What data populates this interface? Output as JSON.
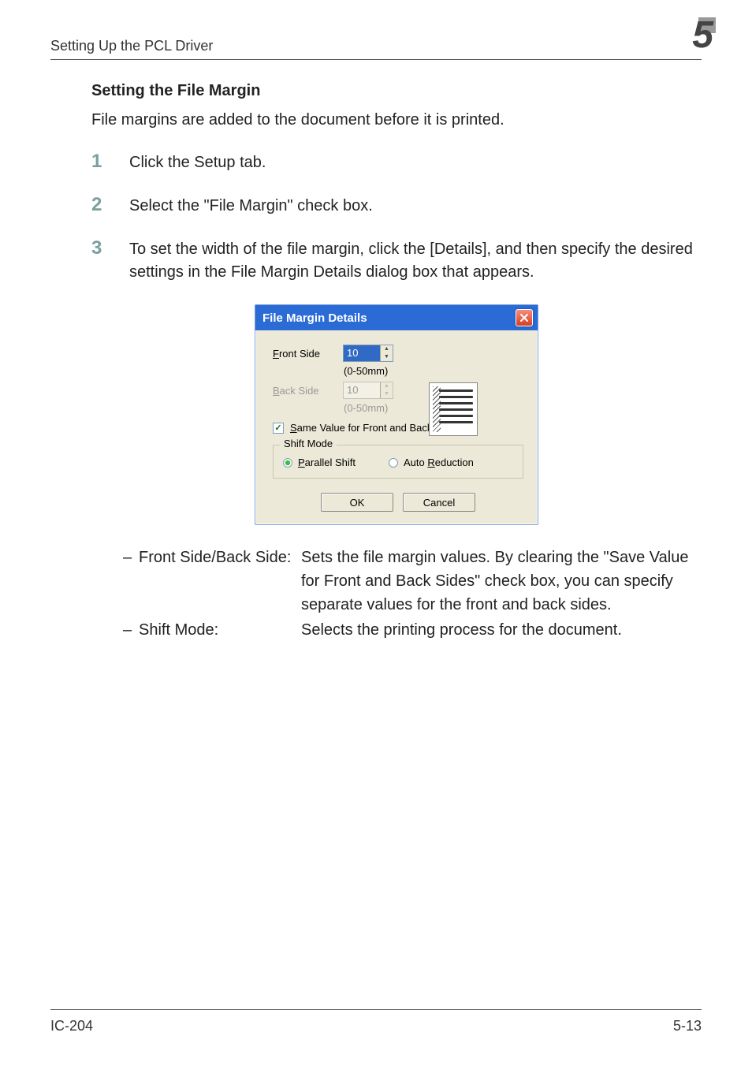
{
  "header": {
    "section_title": "Setting Up the PCL Driver",
    "chapter_number": "5"
  },
  "section": {
    "heading": "Setting the File Margin",
    "intro": "File margins are added to the document before it is printed."
  },
  "steps": {
    "s1_num": "1",
    "s1_text": "Click the Setup tab.",
    "s2_num": "2",
    "s2_text": "Select the \"File Margin\" check box.",
    "s3_num": "3",
    "s3_text": "To set the width of the file margin, click the [Details], and then specify the desired settings in the File Margin Details dialog box that appears."
  },
  "dialog": {
    "title": "File Margin Details",
    "front_label_pre": "F",
    "front_label_post": "ront Side",
    "back_label_pre": "B",
    "back_label_post": "ack Side",
    "front_value": "10",
    "back_value": "10",
    "range_front": "(0-50mm)",
    "range_back": "(0-50mm)",
    "check_pre": "S",
    "check_post": "ame Value for Front and Back Sides",
    "group_legend": "Shift Mode",
    "radio1_pre": "P",
    "radio1_post": "arallel Shift",
    "radio2_pre": "Auto ",
    "radio2_u": "R",
    "radio2_post": "eduction",
    "ok": "OK",
    "cancel": "Cancel"
  },
  "definitions": {
    "dash": "–",
    "t1": "Front Side/Back Side:",
    "d1": "Sets the file margin values. By clearing the \"Save Value for Front and Back Sides\" check box, you can specify separate values for the front and back sides.",
    "t2": "Shift Mode:",
    "d2": "Selects the printing process for the document."
  },
  "footer": {
    "left": "IC-204",
    "right": "5-13"
  }
}
